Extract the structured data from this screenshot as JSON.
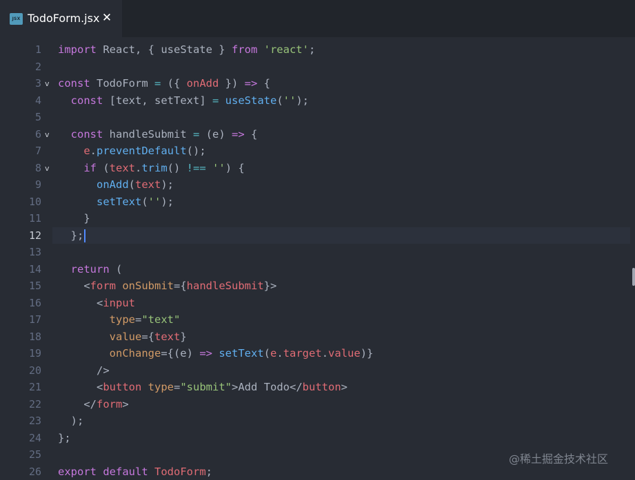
{
  "tab": {
    "icon_label": "JSX",
    "title": "TodoForm.jsx",
    "close_glyph": "✕"
  },
  "editor": {
    "active_line": 12,
    "lines": [
      {
        "n": "1",
        "fold": "",
        "tokens": [
          [
            "k",
            "import"
          ],
          [
            "p",
            " React, { useState } "
          ],
          [
            "k",
            "from"
          ],
          [
            "p",
            " "
          ],
          [
            "s",
            "'react'"
          ],
          [
            "p",
            ";"
          ]
        ]
      },
      {
        "n": "2",
        "fold": "",
        "tokens": []
      },
      {
        "n": "3",
        "fold": "v",
        "tokens": [
          [
            "k",
            "const"
          ],
          [
            "p",
            " TodoForm "
          ],
          [
            "o",
            "="
          ],
          [
            "p",
            " ({ "
          ],
          [
            "v",
            "onAdd"
          ],
          [
            "p",
            " }) "
          ],
          [
            "k",
            "=>"
          ],
          [
            "p",
            " {"
          ]
        ]
      },
      {
        "n": "4",
        "fold": "",
        "tokens": [
          [
            "p",
            "  "
          ],
          [
            "k",
            "const"
          ],
          [
            "p",
            " [text, setText] "
          ],
          [
            "o",
            "="
          ],
          [
            "p",
            " "
          ],
          [
            "f",
            "useState"
          ],
          [
            "p",
            "("
          ],
          [
            "s",
            "''"
          ],
          [
            "p",
            ");"
          ]
        ]
      },
      {
        "n": "5",
        "fold": "",
        "tokens": []
      },
      {
        "n": "6",
        "fold": "v",
        "tokens": [
          [
            "p",
            "  "
          ],
          [
            "k",
            "const"
          ],
          [
            "p",
            " handleSubmit "
          ],
          [
            "o",
            "="
          ],
          [
            "p",
            " (e) "
          ],
          [
            "k",
            "=>"
          ],
          [
            "p",
            " {"
          ]
        ]
      },
      {
        "n": "7",
        "fold": "",
        "tokens": [
          [
            "p",
            "    "
          ],
          [
            "v",
            "e"
          ],
          [
            "p",
            "."
          ],
          [
            "f",
            "preventDefault"
          ],
          [
            "p",
            "();"
          ]
        ]
      },
      {
        "n": "8",
        "fold": "v",
        "tokens": [
          [
            "p",
            "    "
          ],
          [
            "k",
            "if"
          ],
          [
            "p",
            " ("
          ],
          [
            "v",
            "text"
          ],
          [
            "p",
            "."
          ],
          [
            "f",
            "trim"
          ],
          [
            "p",
            "() "
          ],
          [
            "o",
            "!=="
          ],
          [
            "p",
            " "
          ],
          [
            "s",
            "''"
          ],
          [
            "p",
            ") {"
          ]
        ]
      },
      {
        "n": "9",
        "fold": "",
        "tokens": [
          [
            "p",
            "      "
          ],
          [
            "f",
            "onAdd"
          ],
          [
            "p",
            "("
          ],
          [
            "v",
            "text"
          ],
          [
            "p",
            ");"
          ]
        ]
      },
      {
        "n": "10",
        "fold": "",
        "tokens": [
          [
            "p",
            "      "
          ],
          [
            "f",
            "setText"
          ],
          [
            "p",
            "("
          ],
          [
            "s",
            "''"
          ],
          [
            "p",
            ");"
          ]
        ]
      },
      {
        "n": "11",
        "fold": "",
        "tokens": [
          [
            "p",
            "    }"
          ]
        ]
      },
      {
        "n": "12",
        "fold": "",
        "tokens": [
          [
            "p",
            "  };"
          ]
        ],
        "cursor": true
      },
      {
        "n": "13",
        "fold": "",
        "tokens": []
      },
      {
        "n": "14",
        "fold": "",
        "tokens": [
          [
            "p",
            "  "
          ],
          [
            "k",
            "return"
          ],
          [
            "p",
            " ("
          ]
        ]
      },
      {
        "n": "15",
        "fold": "",
        "tokens": [
          [
            "p",
            "    <"
          ],
          [
            "t",
            "form"
          ],
          [
            "p",
            " "
          ],
          [
            "a",
            "onSubmit"
          ],
          [
            "p",
            "={"
          ],
          [
            "v",
            "handleSubmit"
          ],
          [
            "p",
            "}>"
          ]
        ]
      },
      {
        "n": "16",
        "fold": "",
        "tokens": [
          [
            "p",
            "      <"
          ],
          [
            "t",
            "input"
          ]
        ]
      },
      {
        "n": "17",
        "fold": "",
        "tokens": [
          [
            "p",
            "        "
          ],
          [
            "a",
            "type"
          ],
          [
            "p",
            "="
          ],
          [
            "s",
            "\"text\""
          ]
        ]
      },
      {
        "n": "18",
        "fold": "",
        "tokens": [
          [
            "p",
            "        "
          ],
          [
            "a",
            "value"
          ],
          [
            "p",
            "={"
          ],
          [
            "v",
            "text"
          ],
          [
            "p",
            "}"
          ]
        ]
      },
      {
        "n": "19",
        "fold": "",
        "tokens": [
          [
            "p",
            "        "
          ],
          [
            "a",
            "onChange"
          ],
          [
            "p",
            "={(e) "
          ],
          [
            "k",
            "=>"
          ],
          [
            "p",
            " "
          ],
          [
            "f",
            "setText"
          ],
          [
            "p",
            "("
          ],
          [
            "v",
            "e"
          ],
          [
            "p",
            "."
          ],
          [
            "v",
            "target"
          ],
          [
            "p",
            "."
          ],
          [
            "v",
            "value"
          ],
          [
            "p",
            ")}"
          ]
        ]
      },
      {
        "n": "20",
        "fold": "",
        "tokens": [
          [
            "p",
            "      />"
          ]
        ]
      },
      {
        "n": "21",
        "fold": "",
        "tokens": [
          [
            "p",
            "      <"
          ],
          [
            "t",
            "button"
          ],
          [
            "p",
            " "
          ],
          [
            "a",
            "type"
          ],
          [
            "p",
            "="
          ],
          [
            "s",
            "\"submit\""
          ],
          [
            "p",
            ">Add Todo</"
          ],
          [
            "t",
            "button"
          ],
          [
            "p",
            ">"
          ]
        ]
      },
      {
        "n": "22",
        "fold": "",
        "tokens": [
          [
            "p",
            "    </"
          ],
          [
            "t",
            "form"
          ],
          [
            "p",
            ">"
          ]
        ]
      },
      {
        "n": "23",
        "fold": "",
        "tokens": [
          [
            "p",
            "  );"
          ]
        ]
      },
      {
        "n": "24",
        "fold": "",
        "tokens": [
          [
            "p",
            "};"
          ]
        ]
      },
      {
        "n": "25",
        "fold": "",
        "tokens": []
      },
      {
        "n": "26",
        "fold": "",
        "tokens": [
          [
            "k",
            "export"
          ],
          [
            "p",
            " "
          ],
          [
            "k",
            "default"
          ],
          [
            "p",
            " "
          ],
          [
            "v",
            "TodoForm"
          ],
          [
            "p",
            ";"
          ]
        ]
      }
    ]
  },
  "watermark": "@稀土掘金技术社区"
}
